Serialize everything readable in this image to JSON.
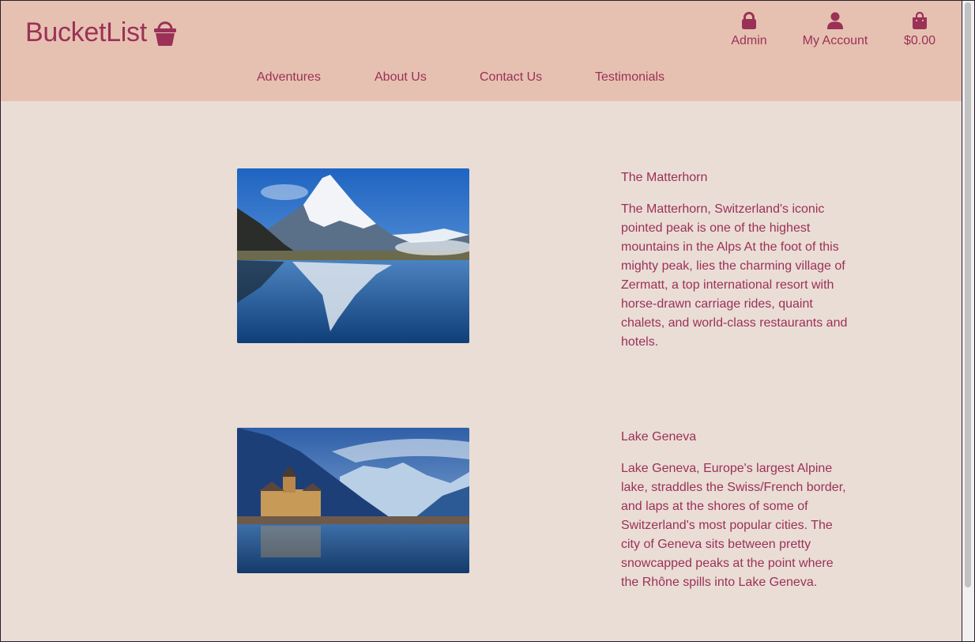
{
  "brand": {
    "name": "BucketList",
    "icon": "basket-icon"
  },
  "header_links": [
    {
      "label": "Admin",
      "icon": "lock-icon"
    },
    {
      "label": "My Account",
      "icon": "user-icon"
    },
    {
      "label": "$0.00",
      "icon": "shopping-bag-icon"
    }
  ],
  "nav": [
    "Adventures",
    "About Us",
    "Contact Us",
    "Testimonials"
  ],
  "destinations": [
    {
      "title": "The Matterhorn",
      "description": "The Matterhorn, Switzerland's iconic pointed peak is one of the highest mountains in the Alps At the foot of this mighty peak, lies the charming village of Zermatt, a top international resort with horse-drawn carriage rides, quaint chalets, and world-class restaurants and hotels."
    },
    {
      "title": "Lake Geneva",
      "description": "Lake Geneva, Europe's largest Alpine lake, straddles the Swiss/French border, and laps at the shores of some of Switzerland's most popular cities. The city of Geneva sits between pretty snowcapped peaks at the point where the Rhône spills into Lake Geneva."
    }
  ],
  "colors": {
    "header_bg": "#e6c1b1",
    "page_bg": "#eaddd6",
    "accent": "#9b3157"
  }
}
